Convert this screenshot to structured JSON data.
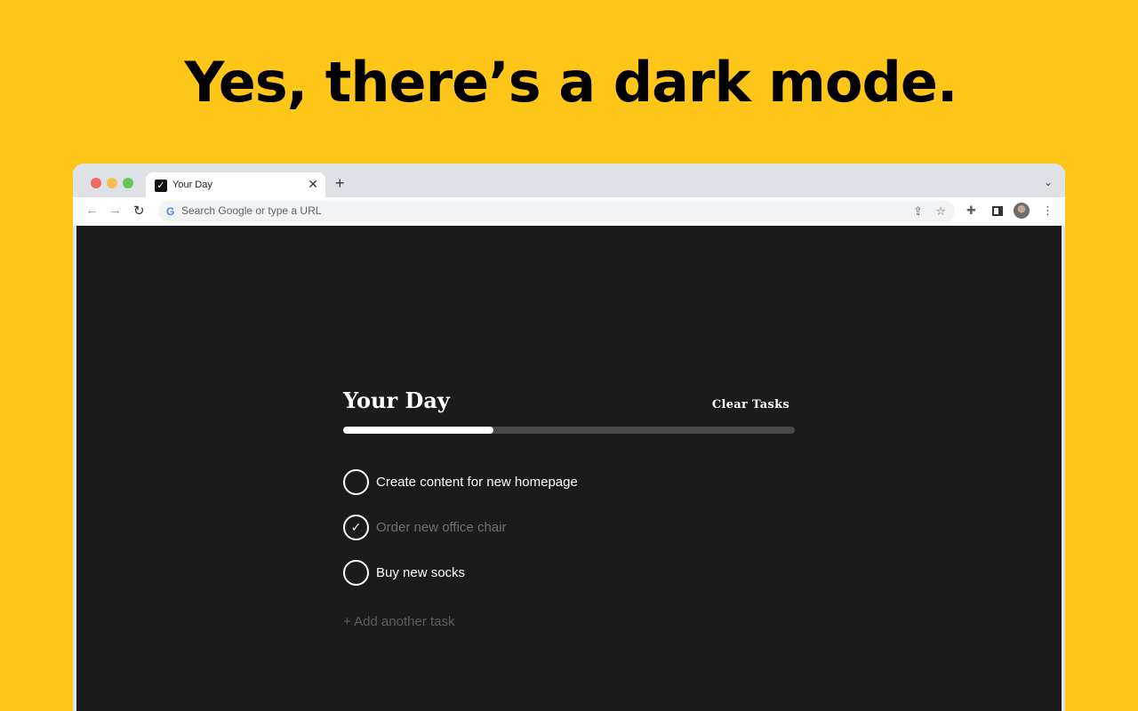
{
  "headline": "Yes, there’s a dark mode.",
  "browser": {
    "tab_title": "Your Day",
    "tab_close": "✕",
    "new_tab": "+",
    "tab_dropdown": "⌄",
    "omnibox_placeholder": "Search Google or type a URL",
    "omnibox_value": ""
  },
  "app": {
    "title": "Your Day",
    "clear_label": "Clear Tasks",
    "progress": 0.333,
    "tasks": [
      {
        "text": "Create content for new homepage",
        "done": false
      },
      {
        "text": "Order new office chair",
        "done": true
      },
      {
        "text": "Buy new socks",
        "done": false
      }
    ],
    "add_task_label": "+ Add another task"
  },
  "colors": {
    "background": "#FFC61A",
    "app_background": "#1b1b1b",
    "progress_fill": "#ffffff",
    "progress_track": "#4a4a4a"
  }
}
